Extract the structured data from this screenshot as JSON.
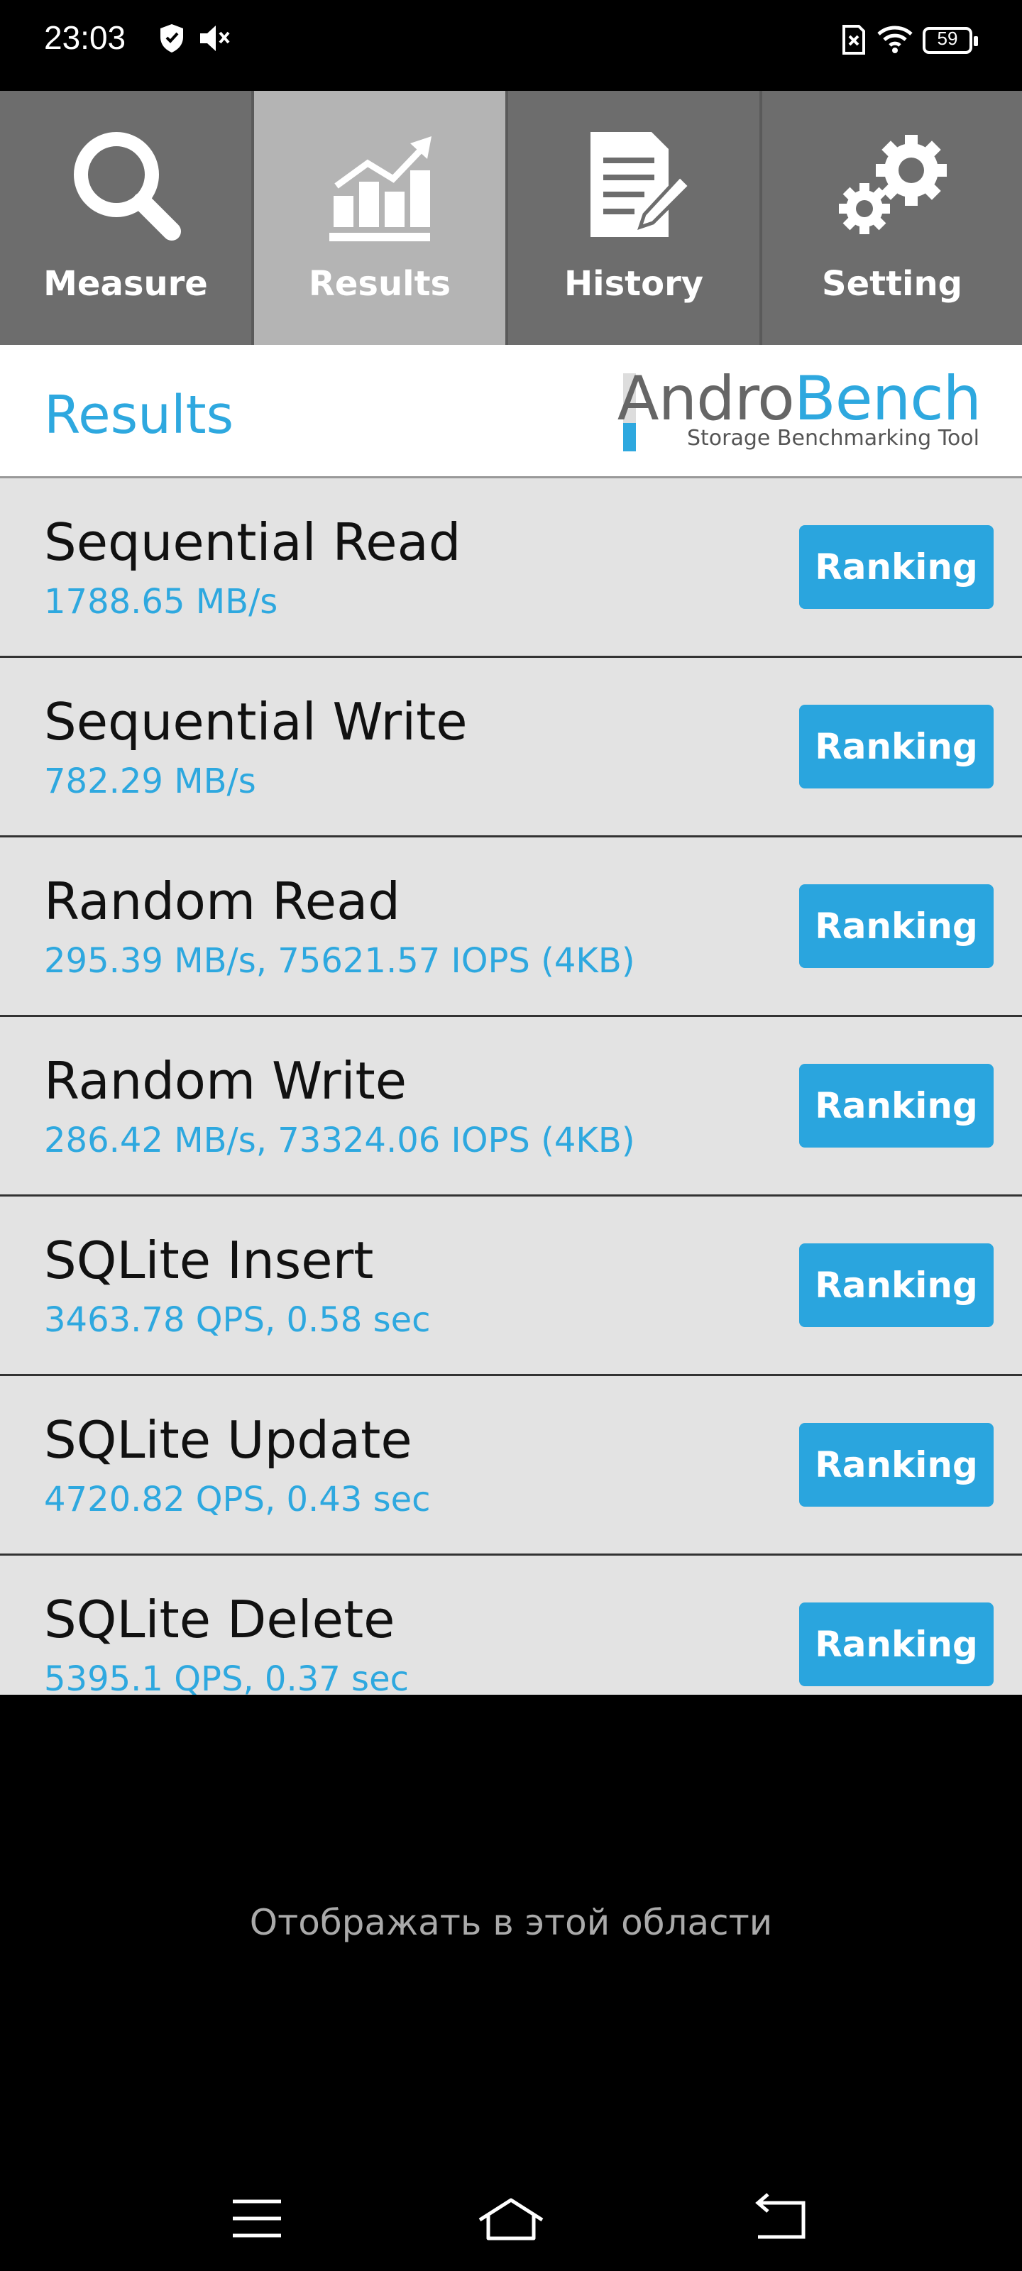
{
  "status_bar": {
    "time": "23:03",
    "battery": "59",
    "icons": [
      "shield-icon",
      "mute-icon",
      "no-sim-icon",
      "wifi-icon",
      "battery-icon"
    ]
  },
  "tabs": [
    {
      "label": "Measure",
      "icon": "magnifier-icon",
      "active": false
    },
    {
      "label": "Results",
      "icon": "chart-icon",
      "active": true
    },
    {
      "label": "History",
      "icon": "document-icon",
      "active": false
    },
    {
      "label": "Setting",
      "icon": "gears-icon",
      "active": false
    }
  ],
  "header": {
    "title": "Results",
    "logo_andro": "Andro",
    "logo_bench": "Bench",
    "logo_subtitle": "Storage Benchmarking Tool"
  },
  "results": [
    {
      "name": "Sequential Read",
      "value": "1788.65 MB/s",
      "button": "Ranking"
    },
    {
      "name": "Sequential Write",
      "value": "782.29 MB/s",
      "button": "Ranking"
    },
    {
      "name": "Random Read",
      "value": "295.39 MB/s, 75621.57 IOPS (4KB)",
      "button": "Ranking"
    },
    {
      "name": "Random Write",
      "value": "286.42 MB/s, 73324.06 IOPS (4KB)",
      "button": "Ranking"
    },
    {
      "name": "SQLite Insert",
      "value": "3463.78 QPS, 0.58 sec",
      "button": "Ranking"
    },
    {
      "name": "SQLite Update",
      "value": "4720.82 QPS, 0.43 sec",
      "button": "Ranking"
    },
    {
      "name": "SQLite Delete",
      "value": "5395.1 QPS, 0.37 sec",
      "button": "Ranking"
    }
  ],
  "ad_area": {
    "text": "Отображать в этой области"
  },
  "nav_bar": {
    "icons": [
      "menu-icon",
      "home-icon",
      "back-icon"
    ]
  },
  "colors": {
    "accent": "#2ea8df",
    "tab_bg": "#6d6d6d",
    "tab_active": "#b4b4b4",
    "list_bg": "#e3e3e3"
  }
}
